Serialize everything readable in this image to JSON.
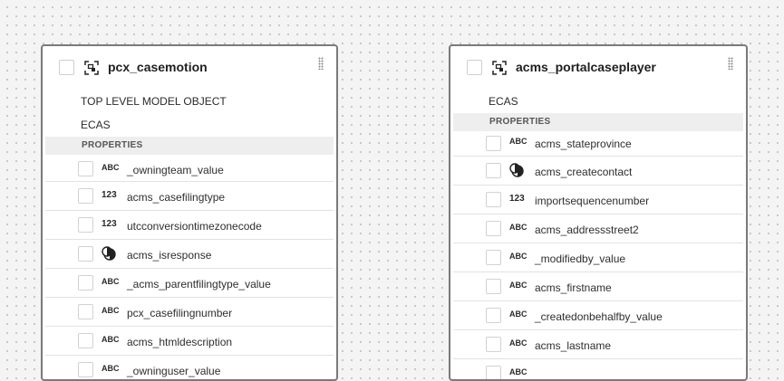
{
  "left_entity": {
    "name": "pcx_casemotion",
    "meta_lines": [
      "TOP LEVEL MODEL OBJECT",
      "ECAS"
    ],
    "properties_label": "PROPERTIES",
    "properties": [
      {
        "type": "ABC",
        "name": "_owningteam_value"
      },
      {
        "type": "123",
        "name": "acms_casefilingtype"
      },
      {
        "type": "123",
        "name": "utcconversiontimezonecode"
      },
      {
        "type": "choice-icon",
        "name": "acms_isresponse"
      },
      {
        "type": "ABC",
        "name": "_acms_parentfilingtype_value"
      },
      {
        "type": "ABC",
        "name": "pcx_casefilingnumber"
      },
      {
        "type": "ABC",
        "name": "acms_htmldescription"
      },
      {
        "type": "ABC",
        "name": "_owninguser_value"
      }
    ]
  },
  "right_entity": {
    "name": "acms_portalcaseplayer",
    "meta_lines": [
      "ECAS"
    ],
    "properties_label": "PROPERTIES",
    "properties": [
      {
        "type": "ABC",
        "name": "acms_stateprovince"
      },
      {
        "type": "choice-icon",
        "name": "acms_createcontact"
      },
      {
        "type": "123",
        "name": "importsequencenumber"
      },
      {
        "type": "ABC",
        "name": "acms_addressstreet2"
      },
      {
        "type": "ABC",
        "name": "_modifiedby_value"
      },
      {
        "type": "ABC",
        "name": "acms_firstname"
      },
      {
        "type": "ABC",
        "name": "_createdonbehalfby_value"
      },
      {
        "type": "ABC",
        "name": "acms_lastname"
      },
      {
        "type": "ABC",
        "name": ""
      }
    ]
  }
}
